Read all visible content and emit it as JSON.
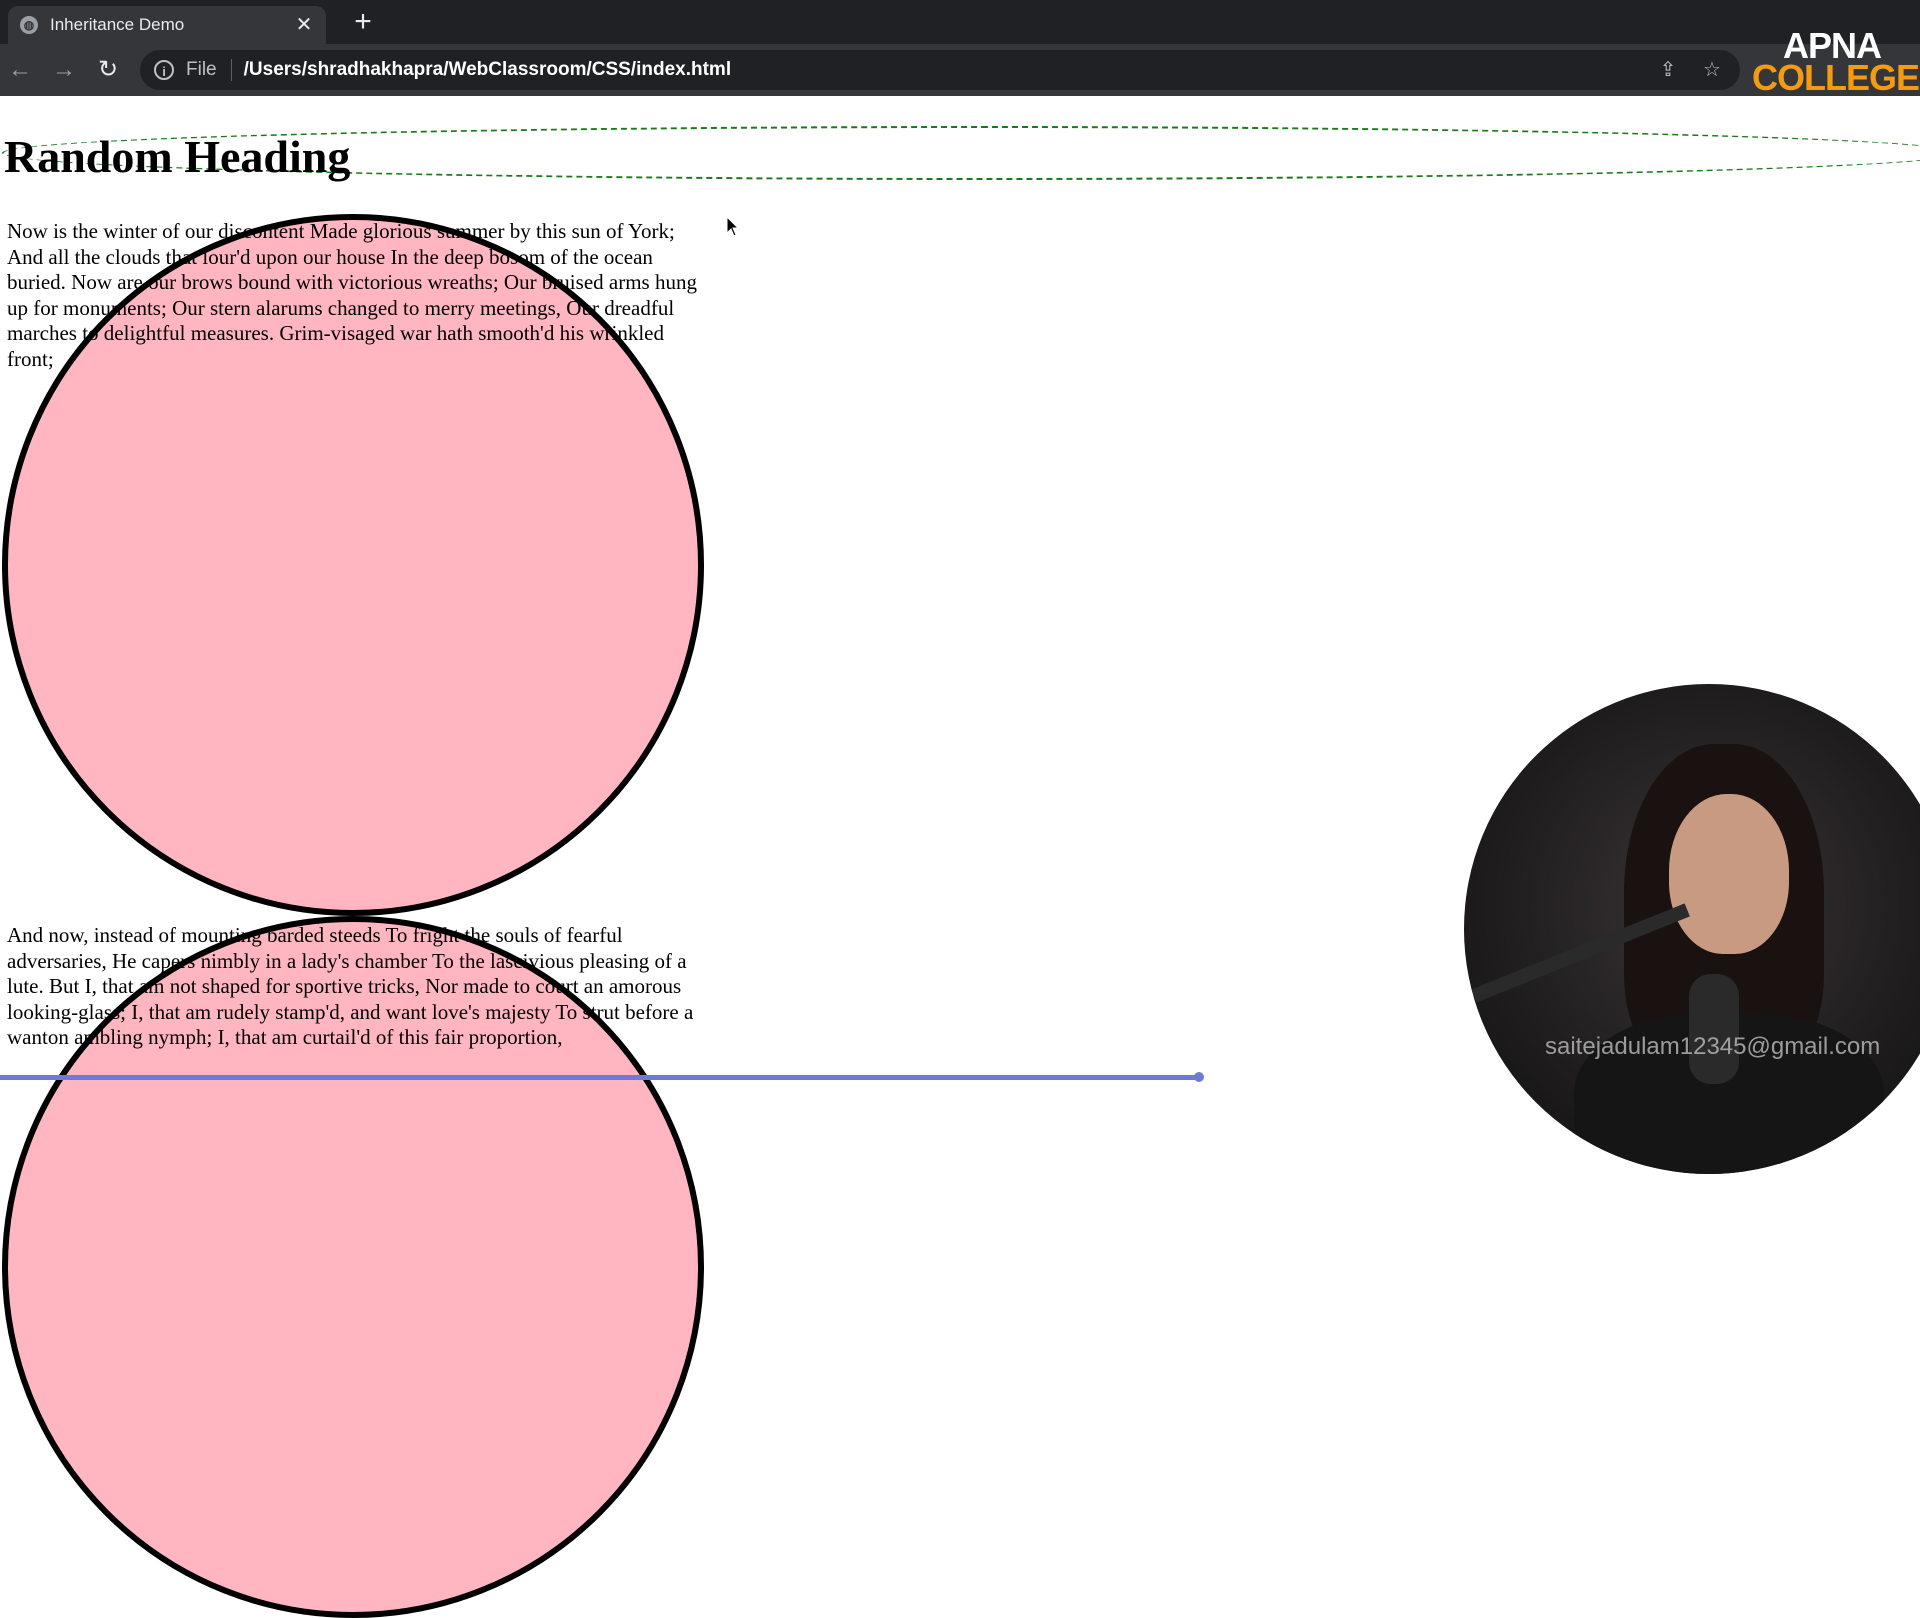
{
  "browser": {
    "tab_title": "Inheritance Demo",
    "tab_close": "✕",
    "new_tab": "+",
    "scheme_label": "File",
    "url": "/Users/shradhakhapra/WebClassroom/CSS/index.html"
  },
  "brand": {
    "line1": "APNA",
    "line2": "COLLEGE"
  },
  "page": {
    "heading": "Random Heading",
    "paragraph1": "Now is the winter of our discontent Made glorious summer by this sun of York; And all the clouds that lour'd upon our house In the deep bosom of the ocean buried. Now are our brows bound with victorious wreaths; Our bruised arms hung up for monuments; Our stern alarums changed to merry meetings, Our dreadful marches to delightful measures. Grim-visaged war hath smooth'd his wrinkled front;",
    "paragraph2": "And now, instead of mounting barded steeds To fright the souls of fearful adversaries, He capers nimbly in a lady's chamber To the lascivious pleasing of a lute. But I, that am not shaped for sportive tricks, Nor made to court an amorous looking-glass; I, that am rudely stamp'd, and want love's majesty To strut before a wanton ambling nymph; I, that am curtail'd of this fair proportion,"
  },
  "overlay": {
    "watermark_email": "saitejadulam12345@gmail.com"
  },
  "colors": {
    "circle_fill": "#ffb6c1",
    "heading_outline": "#1a7a1a",
    "progress": "#6f7ad6"
  },
  "icons": [
    "globe-icon",
    "close-icon",
    "plus-icon",
    "back-icon",
    "forward-icon",
    "reload-icon",
    "info-icon",
    "share-icon",
    "star-icon",
    "mouse-cursor-icon"
  ]
}
